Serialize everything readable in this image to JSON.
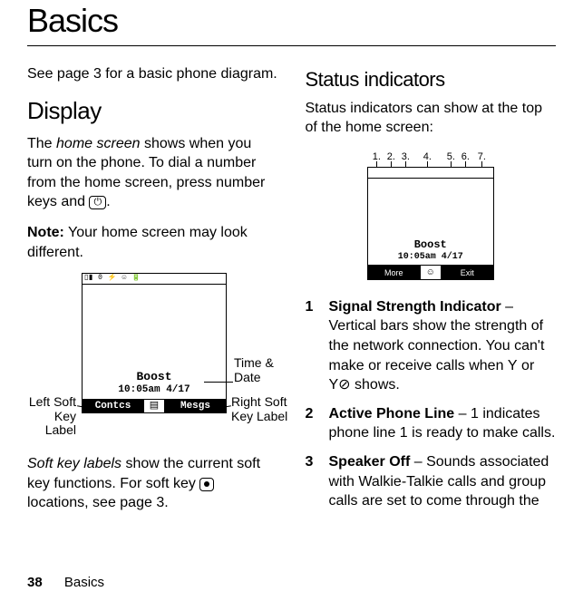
{
  "page": {
    "title": "Basics",
    "number": "38",
    "footer_label": "Basics"
  },
  "left": {
    "intro": "See page 3 for a basic phone diagram.",
    "display_heading": "Display",
    "p1_a": "The ",
    "p1_i": "home screen",
    "p1_b": " shows when you turn on the phone. To dial a number from the home screen, press number keys and ",
    "p1_c": ".",
    "note_label": "Note:",
    "note_text": " Your home screen may look different.",
    "soft_a": "Soft key labels",
    "soft_b": " show the current soft key functions. For soft key ",
    "soft_c": " locations, see page 3.",
    "phone": {
      "status_text": "▯▮ 0 ⚡   ☺        🔋",
      "brand": "Boost",
      "time": "10:05am 4/17",
      "sk_left": "Contcs",
      "sk_mid": "▤",
      "sk_right": "Mesgs"
    },
    "ann_time": "Time & Date",
    "ann_left": "Left Soft Key Label",
    "ann_right": "Right Soft Key Label"
  },
  "right": {
    "heading": "Status indicators",
    "intro": "Status indicators can show at the top of the home screen:",
    "nums": [
      "1.",
      "2.",
      "3.",
      "4.",
      "5.",
      "6.",
      "7."
    ],
    "phone": {
      "brand": "Boost",
      "time": "10:05am 4/17",
      "more": "More",
      "mid": "☺",
      "exit": "Exit"
    },
    "items": [
      {
        "num": "1",
        "title": "Signal Strength Indicator",
        "rest": " – Vertical bars show the strength of the network connection. You can't make or receive calls when ",
        "tail": " shows."
      },
      {
        "num": "2",
        "title": "Active Phone Line",
        "rest": " – 1 indicates phone line 1 is ready to make calls."
      },
      {
        "num": "3",
        "title": "Speaker Off",
        "rest": " – Sounds associated with Walkie-Talkie calls and group calls are set to come through the"
      }
    ]
  }
}
